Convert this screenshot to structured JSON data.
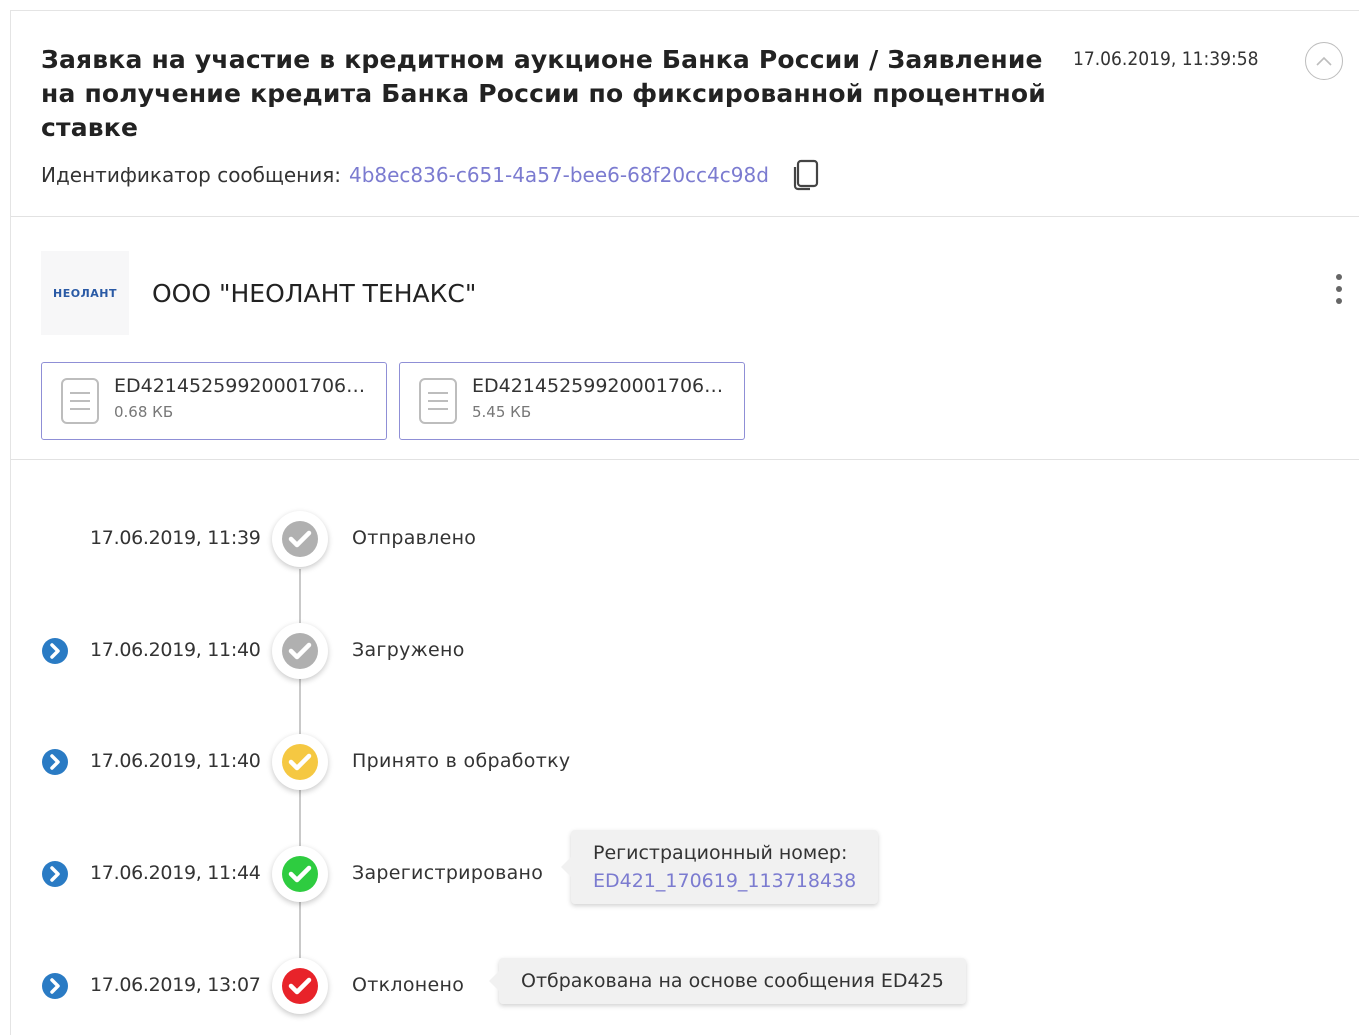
{
  "header": {
    "title": "Заявка на участие в кредитном аукционе Банка России / Заявление на получение кредита Банка России по фиксированной процентной ставке",
    "datetime": "17.06.2019, 11:39:58",
    "message_id_label": "Идентификатор сообщения:",
    "message_id": "4b8ec836-c651-4a57-bee6-68f20cc4c98d"
  },
  "organization": {
    "logo_text": "НЕОЛАНТ",
    "name": "ООО \"НЕОЛАНТ ТЕНАКС\""
  },
  "files": [
    {
      "name": "ED4214525992000170620190617...",
      "size": "0.68 КБ"
    },
    {
      "name": "ED4214525992000170620190617...",
      "size": "5.45 КБ"
    }
  ],
  "timeline": [
    {
      "datetime": "17.06.2019, 11:39",
      "status": "Отправлено",
      "state": "grey",
      "has_arrow": false
    },
    {
      "datetime": "17.06.2019, 11:40",
      "status": "Загружено",
      "state": "grey",
      "has_arrow": true
    },
    {
      "datetime": "17.06.2019, 11:40",
      "status": "Принято в обработку",
      "state": "yellow",
      "has_arrow": true
    },
    {
      "datetime": "17.06.2019, 11:44",
      "status": "Зарегистрировано",
      "state": "green",
      "has_arrow": true,
      "note_label": "Регистрационный номер:",
      "note_link": "ED421_170619_113718438"
    },
    {
      "datetime": "17.06.2019, 13:07",
      "status": "Отклонено",
      "state": "red",
      "has_arrow": true,
      "note_text": "Отбракована на основе сообщения ED425"
    }
  ],
  "colors": {
    "grey": "#b0b0b0",
    "yellow": "#f5c842",
    "green": "#2ecc40",
    "red": "#e8232a",
    "link": "#7b7bd0",
    "arrow": "#2a7bc4"
  },
  "icons": {
    "collapse": "chevron-up-icon",
    "copy": "copy-icon",
    "more": "more-vertical-icon",
    "file": "document-icon",
    "arrow": "chevron-right-circle-icon",
    "status": "check-icon"
  }
}
